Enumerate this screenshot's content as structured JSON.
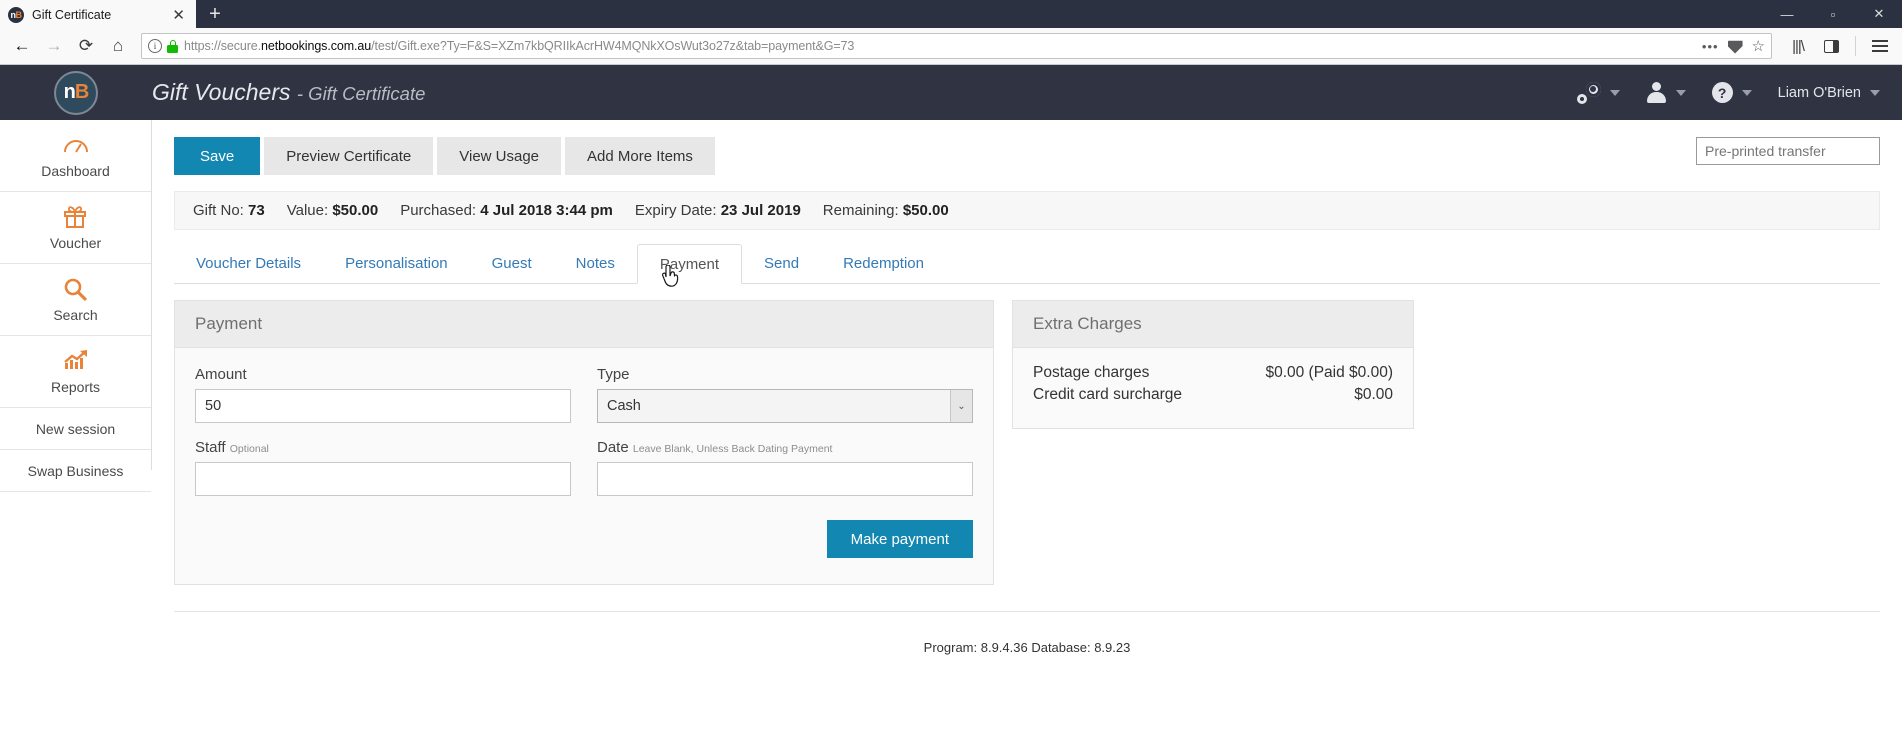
{
  "browser": {
    "tab_title": "Gift Certificate",
    "tab_close": "✕",
    "new_tab": "+",
    "url_prefix": "https://secure.",
    "url_domain": "netbookings.com.au",
    "url_suffix": "/test/Gift.exe?Ty=F&S=XZm7kbQRIIkAcrHW4MQNkXOsWut3o27z&tab=payment&G=73",
    "back_icon": "←",
    "forward_icon": "→",
    "reload_icon": "⟳",
    "home_icon": "⌂",
    "more_icon": "•••",
    "minimize": "—",
    "maximize": "▫",
    "close": "✕"
  },
  "app": {
    "logo_n": "n",
    "logo_b": "B",
    "title": "Gift Vouchers",
    "subtitle": "- Gift Certificate",
    "user_name": "Liam O'Brien",
    "help_glyph": "?"
  },
  "sidebar": {
    "items": [
      {
        "label": "Dashboard",
        "icon": "dashboard-gauge-icon"
      },
      {
        "label": "Voucher",
        "icon": "gift-icon"
      },
      {
        "label": "Search",
        "icon": "magnifier-icon"
      },
      {
        "label": "Reports",
        "icon": "chart-arrow-icon"
      }
    ],
    "text_items": [
      {
        "label": "New session"
      },
      {
        "label": "Swap Business"
      }
    ]
  },
  "toolbar": {
    "save_label": "Save",
    "preview_label": "Preview Certificate",
    "view_usage_label": "View Usage",
    "add_items_label": "Add More Items",
    "preprinted_placeholder": "Pre-printed transfer",
    "preprinted_value": ""
  },
  "info_bar": [
    {
      "key": "Gift No:",
      "value": "73"
    },
    {
      "key": "Value:",
      "value": "$50.00"
    },
    {
      "key": "Purchased:",
      "value": "4 Jul 2018 3:44 pm"
    },
    {
      "key": "Expiry Date:",
      "value": "23 Jul 2019"
    },
    {
      "key": "Remaining:",
      "value": "$50.00"
    }
  ],
  "tabs": [
    {
      "label": "Voucher Details",
      "active": false
    },
    {
      "label": "Personalisation",
      "active": false
    },
    {
      "label": "Guest",
      "active": false
    },
    {
      "label": "Notes",
      "active": false
    },
    {
      "label": "Payment",
      "active": true
    },
    {
      "label": "Send",
      "active": false
    },
    {
      "label": "Redemption",
      "active": false
    }
  ],
  "payment": {
    "card_title": "Payment",
    "amount_label": "Amount",
    "amount_value": "50",
    "type_label": "Type",
    "type_value": "Cash",
    "type_options": [
      "Cash"
    ],
    "staff_label": "Staff",
    "staff_hint": "Optional",
    "staff_value": "",
    "date_label": "Date",
    "date_hint": "Leave Blank, Unless Back Dating Payment",
    "date_value": "",
    "make_payment_label": "Make payment"
  },
  "extra_charges": {
    "card_title": "Extra Charges",
    "lines": [
      {
        "label": "Postage charges",
        "value": "$0.00 (Paid $0.00)"
      },
      {
        "label": "Credit card surcharge",
        "value": "$0.00"
      }
    ]
  },
  "footer": {
    "text": "Program: 8.9.4.36 Database: 8.9.23"
  },
  "colors": {
    "accent": "#1287b1",
    "header_bg": "#2f3342",
    "icon_orange": "#e8833a",
    "link_blue": "#337ab7",
    "highlight_yellow": "#f5f03c"
  }
}
